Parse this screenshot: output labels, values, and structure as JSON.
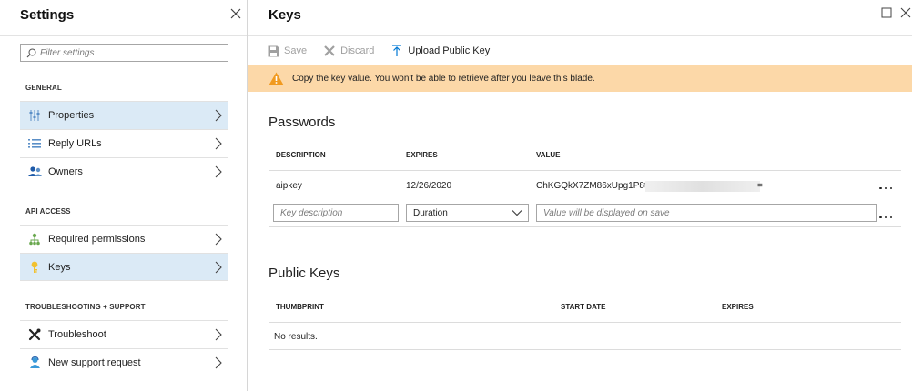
{
  "settings": {
    "title": "Settings",
    "filter_placeholder": "Filter settings",
    "sections": {
      "general": "GENERAL",
      "api_access": "API ACCESS",
      "troubleshooting": "TROUBLESHOOTING + SUPPORT"
    },
    "items": {
      "properties": "Properties",
      "reply_urls": "Reply URLs",
      "owners": "Owners",
      "required_permissions": "Required permissions",
      "keys": "Keys",
      "troubleshoot": "Troubleshoot",
      "new_support_request": "New support request"
    },
    "selected_item": "Keys"
  },
  "keys": {
    "title": "Keys",
    "toolbar": {
      "save": "Save",
      "discard": "Discard",
      "upload": "Upload Public Key"
    },
    "warning": "Copy the key value. You won't be able to retrieve after you leave this blade.",
    "passwords": {
      "heading": "Passwords",
      "columns": {
        "description": "DESCRIPTION",
        "expires": "EXPIRES",
        "value": "VALUE"
      },
      "rows": [
        {
          "description": "aipkey",
          "expires": "12/26/2020",
          "value_prefix": "ChKGQkX7ZM86xUpg1P8t",
          "value_suffix": "="
        }
      ],
      "new_row": {
        "description_placeholder": "Key description",
        "duration_selected": "Duration",
        "value_placeholder": "Value will be displayed on save"
      }
    },
    "public_keys": {
      "heading": "Public Keys",
      "columns": {
        "thumbprint": "THUMBPRINT",
        "start_date": "START DATE",
        "expires": "EXPIRES"
      },
      "empty": "No results."
    }
  },
  "colors": {
    "selected_bg": "#dbeaf6",
    "warning_bg": "#fcd8a8",
    "warning_icon": "#f19a1f",
    "accent_blue": "#0078d4",
    "disabled_text": "#a0a0a0"
  }
}
